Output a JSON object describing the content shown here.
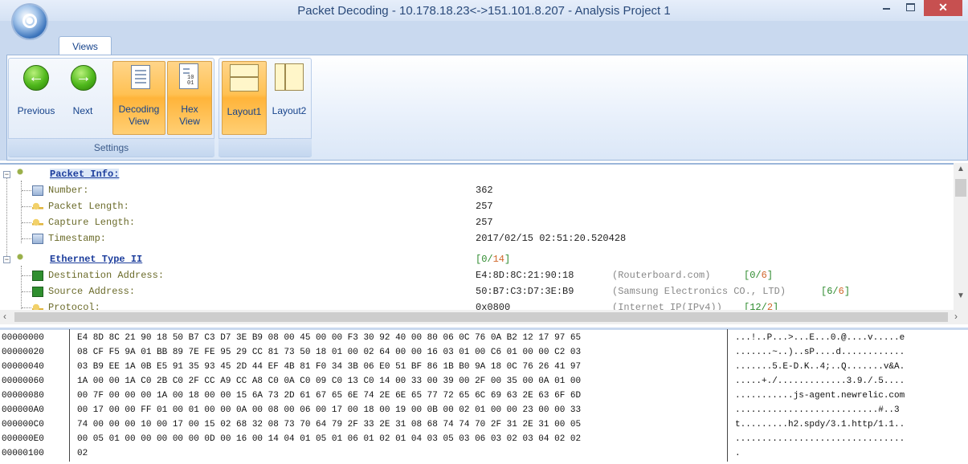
{
  "window": {
    "title": "Packet Decoding - 10.178.18.23<->151.101.8.207 - Analysis Project 1",
    "close": "✕"
  },
  "ribbon": {
    "tab": "Views",
    "group_label": "Settings",
    "buttons": {
      "previous": "Previous",
      "next": "Next",
      "decoding_line1": "Decoding",
      "decoding_line2": "View",
      "hex_line1": "Hex",
      "hex_line2": "View",
      "layout1": "Layout1",
      "layout2": "Layout2"
    }
  },
  "tree": {
    "rows": [
      {
        "name": "Packet Info:",
        "value": "",
        "desc": ""
      },
      {
        "name": "Number:",
        "value": "362",
        "desc": ""
      },
      {
        "name": "Packet Length:",
        "value": "257",
        "desc": ""
      },
      {
        "name": "Capture Length:",
        "value": "257",
        "desc": ""
      },
      {
        "name": "Timestamp:",
        "value": "2017/02/15 02:51:20.520428",
        "desc": ""
      },
      {
        "name": "Ethernet Type II",
        "value": "",
        "desc": "",
        "rng_a": "[0/",
        "rng_b": "14",
        "rng_c": "]"
      },
      {
        "name": "Destination Address:",
        "value": "E4:8D:8C:21:90:18",
        "desc": "(Routerboard.com)",
        "rng_a": "[0/",
        "rng_b": "6",
        "rng_c": "]"
      },
      {
        "name": "Source Address:",
        "value": "50:B7:C3:D7:3E:B9",
        "desc": "(Samsung Electronics CO., LTD)",
        "rng_a": "[6/",
        "rng_b": "6",
        "rng_c": "]"
      },
      {
        "name": "Protocol:",
        "value": "0x0800",
        "desc": "(Internet IP(IPv4))",
        "rng_a": "[12/",
        "rng_b": "2",
        "rng_c": "]"
      }
    ]
  },
  "hex": {
    "rows": [
      {
        "offset": "00000000",
        "bytes": "E4 8D 8C 21 90 18 50 B7 C3 D7 3E B9 08 00 45 00 00 F3 30 92 40 00 80 06 0C 76 0A B2 12 17 97 65",
        "ascii": "...!..P...>...E...0.@....v.....e"
      },
      {
        "offset": "00000020",
        "bytes": "08 CF F5 9A 01 BB 89 7E FE 95 29 CC 81 73 50 18 01 00 02 64 00 00 16 03 01 00 C6 01 00 00 C2 03",
        "ascii": ".......~..)..sP....d............"
      },
      {
        "offset": "00000040",
        "bytes": "03 B9 EE 1A 0B E5 91 35 93 45 2D 44 EF 4B 81 F0 34 3B 06 E0 51 BF 86 1B B0 9A 18 0C 76 26 41 97",
        "ascii": ".......5.E-D.K..4;..Q.......v&A."
      },
      {
        "offset": "00000060",
        "bytes": "1A 00 00 1A C0 2B C0 2F CC A9 CC A8 C0 0A C0 09 C0 13 C0 14 00 33 00 39 00 2F 00 35 00 0A 01 00",
        "ascii": ".....+./.............3.9./.5...."
      },
      {
        "offset": "00000080",
        "bytes": "00 7F 00 00 00 1A 00 18 00 00 15 6A 73 2D 61 67 65 6E 74 2E 6E 65 77 72 65 6C 69 63 2E 63 6F 6D",
        "ascii": "...........js-agent.newrelic.com"
      },
      {
        "offset": "000000A0",
        "bytes": "00 17 00 00 FF 01 00 01 00 00 0A 00 08 00 06 00 17 00 18 00 19 00 0B 00 02 01 00 00 23 00 00 33",
        "ascii": "...........................#..3"
      },
      {
        "offset": "000000C0",
        "bytes": "74 00 00 00 10 00 17 00 15 02 68 32 08 73 70 64 79 2F 33 2E 31 08 68 74 74 70 2F 31 2E 31 00 05",
        "ascii": "t.........h2.spdy/3.1.http/1.1.."
      },
      {
        "offset": "000000E0",
        "bytes": "00 05 01 00 00 00 00 00 0D 00 16 00 14 04 01 05 01 06 01 02 01 04 03 05 03 06 03 02 03 04 02 02",
        "ascii": "................................"
      },
      {
        "offset": "00000100",
        "bytes": "02",
        "ascii": "."
      }
    ]
  },
  "colors": {
    "accent": "#15428b",
    "ribbon_bg": "#c9d9ef",
    "active": "#ffc153",
    "close": "#c75050"
  }
}
